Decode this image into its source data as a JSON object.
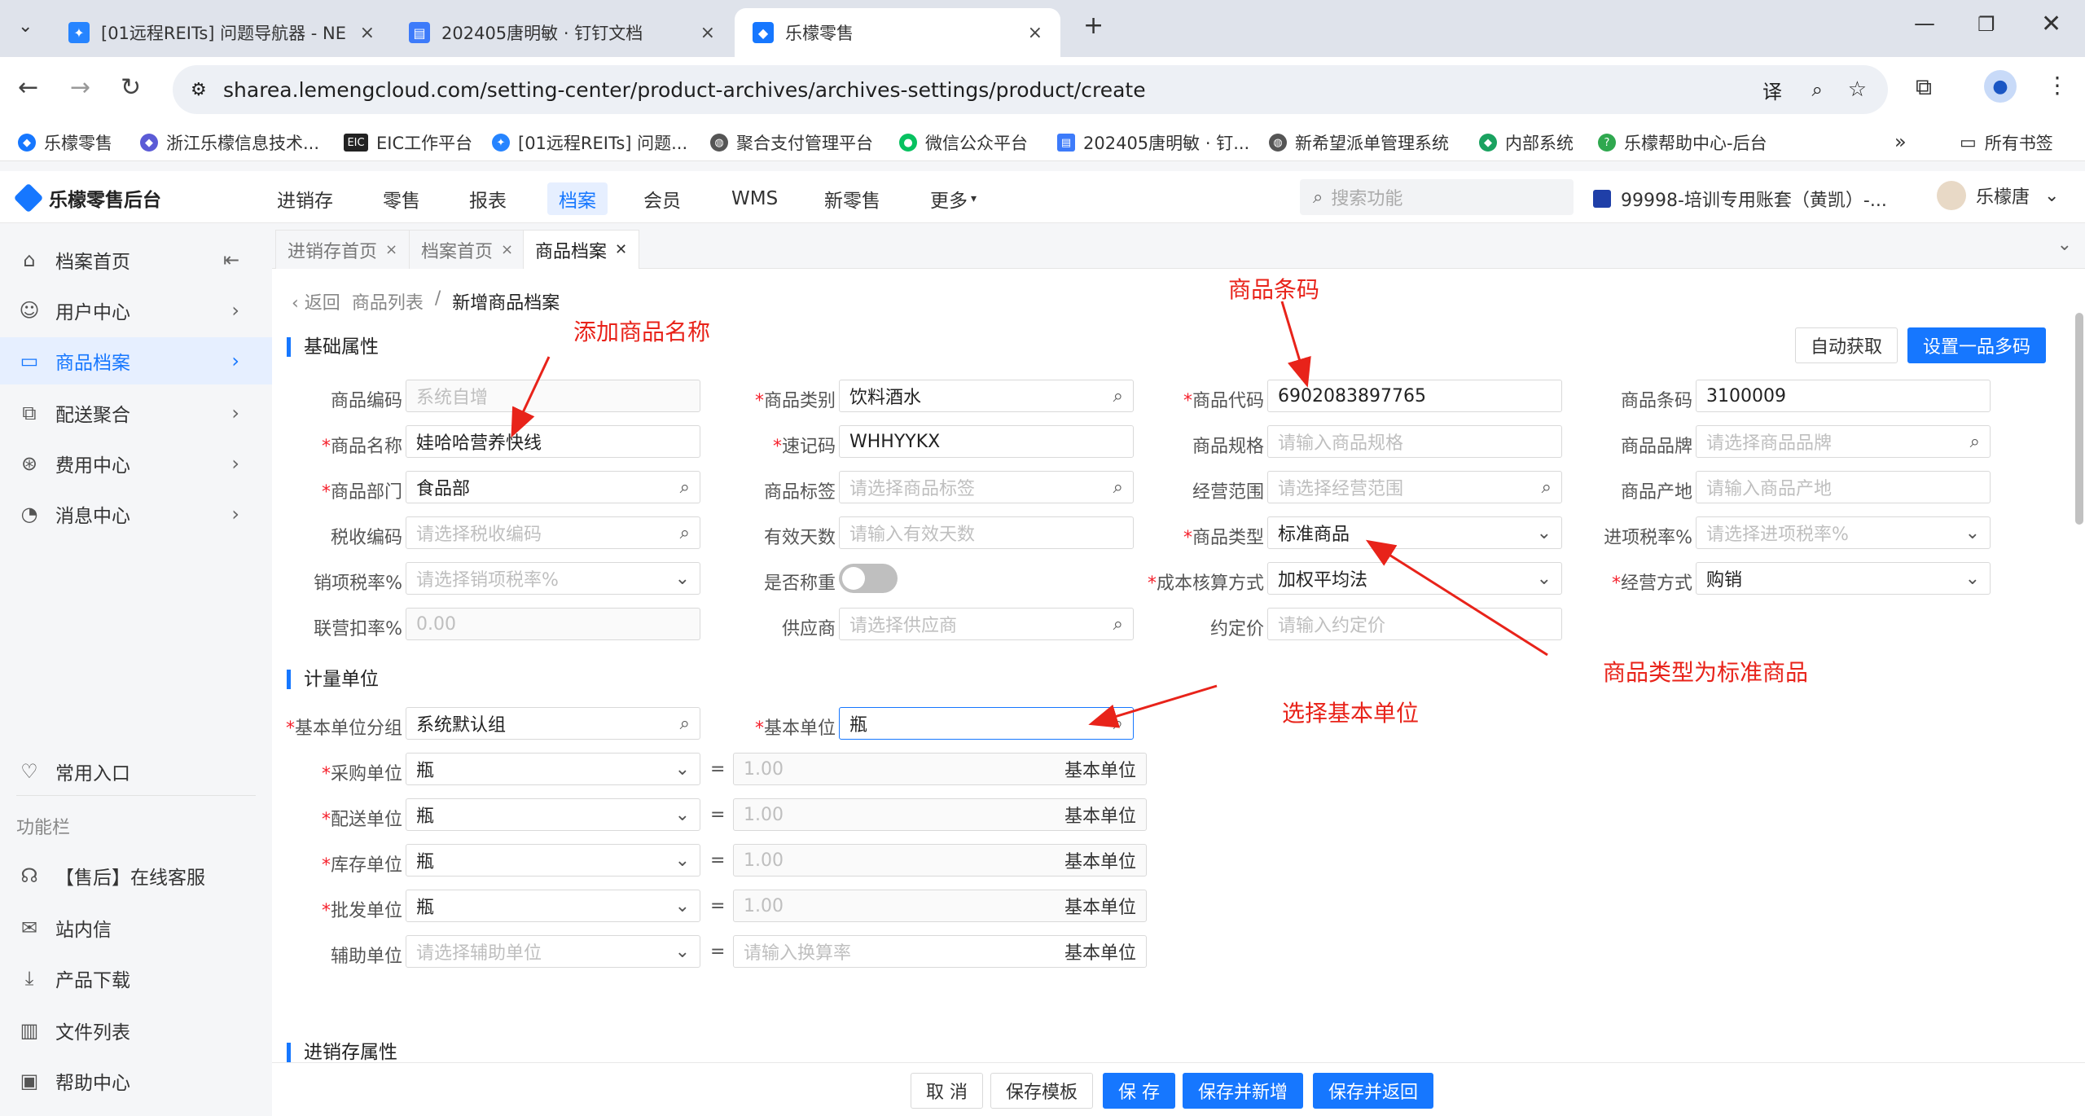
{
  "browser": {
    "tabs": [
      {
        "title": "[01远程REITs] 问题导航器 - NE"
      },
      {
        "title": "202405唐明敏 · 钉钉文档"
      },
      {
        "title": "乐檬零售"
      }
    ],
    "url": "sharea.lemengcloud.com/setting-center/product-archives/archives-settings/product/create",
    "bookmarks": [
      "乐檬零售",
      "浙江乐檬信息技术...",
      "EIC工作平台",
      "[01远程REITs] 问题...",
      "聚合支付管理平台",
      "微信公众平台",
      "202405唐明敏 · 钉...",
      "新希望派单管理系统",
      "内部系统",
      "乐檬帮助中心-后台"
    ],
    "all_bookmarks": "所有书签"
  },
  "header": {
    "logo": "乐檬零售后台",
    "nav": [
      "进销存",
      "零售",
      "报表",
      "档案",
      "会员",
      "WMS",
      "新零售",
      "更多"
    ],
    "search_placeholder": "搜索功能",
    "account": "99998-培训专用账套（黄凯）-...",
    "user": "乐檬唐"
  },
  "sidebar": {
    "items": [
      {
        "label": "档案首页",
        "icon": "home-icon"
      },
      {
        "label": "用户中心",
        "icon": "user-icon"
      },
      {
        "label": "商品档案",
        "icon": "product-icon"
      },
      {
        "label": "配送聚合",
        "icon": "delivery-icon"
      },
      {
        "label": "费用中心",
        "icon": "fee-icon"
      },
      {
        "label": "消息中心",
        "icon": "bell-icon"
      }
    ],
    "common": "常用入口",
    "func_caption": "功能栏",
    "func_items": [
      "【售后】在线客服",
      "站内信",
      "产品下载",
      "文件列表",
      "帮助中心"
    ]
  },
  "page_tabs": [
    "进销存首页",
    "档案首页",
    "商品档案"
  ],
  "breadcrumb": {
    "back": "返回",
    "list": "商品列表",
    "sep": "/",
    "current": "新增商品档案"
  },
  "sections": {
    "basic": "基础属性",
    "unit": "计量单位",
    "stock": "进销存属性"
  },
  "buttons": {
    "auto": "自动获取",
    "multi": "设置一品多码",
    "cancel": "取 消",
    "save_tpl": "保存模板",
    "save": "保 存",
    "save_new": "保存并新增",
    "save_back": "保存并返回"
  },
  "fields": {
    "code": {
      "label": "商品编码",
      "placeholder": "系统自增"
    },
    "category": {
      "label": "商品类别",
      "value": "饮料酒水"
    },
    "item_code": {
      "label": "商品代码",
      "value": "6902083897765"
    },
    "barcode": {
      "label": "商品条码",
      "value": "3100009"
    },
    "name": {
      "label": "商品名称",
      "value": "娃哈哈营养快线"
    },
    "quick": {
      "label": "速记码",
      "value": "WHHYYKX"
    },
    "spec": {
      "label": "商品规格",
      "placeholder": "请输入商品规格"
    },
    "brand": {
      "label": "商品品牌",
      "placeholder": "请选择商品品牌"
    },
    "dept": {
      "label": "商品部门",
      "value": "食品部"
    },
    "tag": {
      "label": "商品标签",
      "placeholder": "请选择商品标签"
    },
    "scope": {
      "label": "经营范围",
      "placeholder": "请选择经营范围"
    },
    "origin": {
      "label": "商品产地",
      "placeholder": "请输入商品产地"
    },
    "tax_code": {
      "label": "税收编码",
      "placeholder": "请选择税收编码"
    },
    "valid_days": {
      "label": "有效天数",
      "placeholder": "请输入有效天数"
    },
    "type": {
      "label": "商品类型",
      "value": "标准商品"
    },
    "in_tax": {
      "label": "进项税率%",
      "placeholder": "请选择进项税率%"
    },
    "out_tax": {
      "label": "销项税率%",
      "placeholder": "请选择销项税率%"
    },
    "weigh": {
      "label": "是否称重"
    },
    "cost": {
      "label": "成本核算方式",
      "value": "加权平均法"
    },
    "biz_mode": {
      "label": "经营方式",
      "value": "购销"
    },
    "joint": {
      "label": "联营扣率%",
      "placeholder": "0.00"
    },
    "supplier": {
      "label": "供应商",
      "placeholder": "请选择供应商"
    },
    "agreed": {
      "label": "约定价",
      "placeholder": "请输入约定价"
    },
    "unit_group": {
      "label": "基本单位分组",
      "value": "系统默认组"
    },
    "base_unit": {
      "label": "基本单位",
      "value": "瓶"
    },
    "purchase": {
      "label": "采购单位",
      "value": "瓶",
      "ratio": "1.00",
      "suffix": "基本单位"
    },
    "delivery": {
      "label": "配送单位",
      "value": "瓶",
      "ratio": "1.00",
      "suffix": "基本单位"
    },
    "stock": {
      "label": "库存单位",
      "value": "瓶",
      "ratio": "1.00",
      "suffix": "基本单位"
    },
    "wholesale": {
      "label": "批发单位",
      "value": "瓶",
      "ratio": "1.00",
      "suffix": "基本单位"
    },
    "aux": {
      "label": "辅助单位",
      "placeholder": "请选择辅助单位",
      "ratio_ph": "请输入换算率",
      "suffix": "基本单位"
    }
  },
  "annotations": {
    "name": "添加商品名称",
    "barcode": "商品条码",
    "type": "商品类型为标准商品",
    "unit": "选择基本单位"
  },
  "colors": {
    "primary": "#1677ff",
    "annotation": "#e8231a"
  }
}
